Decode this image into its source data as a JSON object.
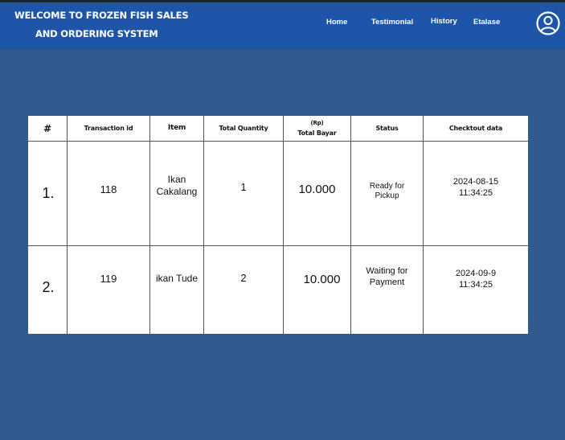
{
  "header": {
    "title_line1": "WELCOME TO FROZEN FISH SALES",
    "title_line2": "AND ORDERING SYSTEM",
    "nav": [
      "Home",
      "Testimonial",
      "History",
      "Etalase"
    ],
    "profile_icon": "user-circle-icon"
  },
  "table": {
    "columns": {
      "number": "#",
      "transaction_id": "Transaction id",
      "item": "Item",
      "total_quantity": "Total Quantity",
      "total_bayar_unit": "(Rp)",
      "total_bayar": "Total Bayar",
      "status": "Status",
      "checkout": "Checktout data"
    },
    "rows": [
      {
        "number": "1.",
        "transaction_id": "118",
        "item": "Ikan Cakalang",
        "quantity": "1",
        "total": "10.000",
        "status": "Ready for Pickup",
        "date": "2024-08-15",
        "time": "11:34:25"
      },
      {
        "number": "2.",
        "transaction_id": "119",
        "item": "ikan Tude",
        "quantity": "2",
        "total": "10.000",
        "status": "Waiting for Payment",
        "date": "2024-09-9",
        "time": "11:34:25"
      }
    ]
  },
  "colors": {
    "page_background": "#325a8e",
    "header_background": "#1f55a8",
    "table_background": "#ffffff"
  }
}
